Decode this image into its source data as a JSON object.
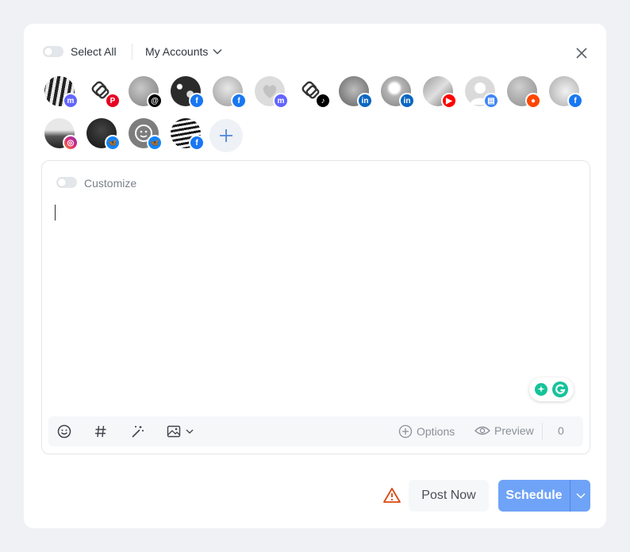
{
  "header": {
    "select_all_label": "Select All",
    "accounts_dropdown_label": "My Accounts"
  },
  "accounts": [
    {
      "network": "mastodon",
      "badge_color": "#6364ff"
    },
    {
      "network": "pinterest",
      "badge_color": "#e60023"
    },
    {
      "network": "threads",
      "badge_color": "#000000"
    },
    {
      "network": "facebook",
      "badge_color": "#1877f2"
    },
    {
      "network": "facebook",
      "badge_color": "#1877f2"
    },
    {
      "network": "mastodon",
      "badge_color": "#6364ff"
    },
    {
      "network": "tiktok",
      "badge_color": "#000000"
    },
    {
      "network": "linkedin",
      "badge_color": "#0a66c2"
    },
    {
      "network": "linkedin",
      "badge_color": "#0a66c2"
    },
    {
      "network": "youtube",
      "badge_color": "#ff0000"
    },
    {
      "network": "google-business",
      "badge_color": "#4285f4"
    },
    {
      "network": "reddit",
      "badge_color": "#ff4500"
    },
    {
      "network": "facebook",
      "badge_color": "#1877f2"
    },
    {
      "network": "instagram",
      "badge_color": "#e1306c"
    },
    {
      "network": "bluesky",
      "badge_color": "#1185fe"
    },
    {
      "network": "bluesky",
      "badge_color": "#1185fe"
    },
    {
      "network": "facebook",
      "badge_color": "#1877f2"
    }
  ],
  "composer": {
    "customize_label": "Customize",
    "text": ""
  },
  "toolbar": {
    "options_label": "Options",
    "preview_label": "Preview",
    "char_count": "0"
  },
  "footer": {
    "post_now_label": "Post Now",
    "schedule_label": "Schedule"
  },
  "colors": {
    "accent": "#6fa3f7",
    "warning": "#d9480f",
    "grammarly": "#15c39a"
  }
}
